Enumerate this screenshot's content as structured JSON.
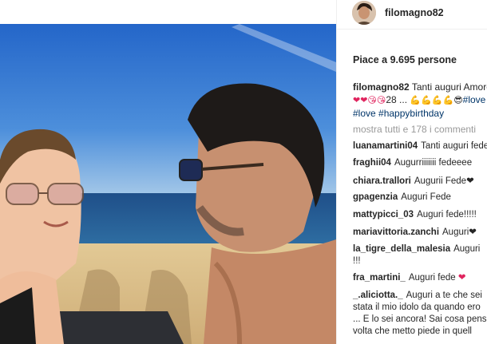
{
  "post": {
    "username": "filomagno82",
    "likes_text": "Piace a 9.695 persone",
    "caption": {
      "username": "filomagno82",
      "text": "Tanti auguri Amore",
      "line2_emoji_a": "❤❤😘😘",
      "line2_text": "28 ...",
      "line2_emoji_b": "💪💪💪💪😎",
      "line2_tag": "#love",
      "tags": [
        "#love",
        "#happybirthday"
      ]
    },
    "view_all": "mostra tutti e 178 i commenti"
  },
  "comments": [
    {
      "user": "luanamartini04",
      "text": "Tanti auguri fede"
    },
    {
      "user": "fraghii04",
      "text": "Augurriiiiiii fedeeee"
    },
    {
      "user": "chiara.trallori",
      "text": "Augurii Fede",
      "suffix": "❤"
    },
    {
      "user": "gpagenzia",
      "text": "Auguri Fede"
    },
    {
      "user": "mattypicci_03",
      "text": "Auguri fede!!!!!"
    },
    {
      "user": "mariavittoria.zanchi",
      "text": "Auguri",
      "suffix": "❤"
    },
    {
      "user": "la_tigre_della_malesia",
      "text": "Auguri",
      "line2": "!!!"
    },
    {
      "user": "fra_martini_",
      "text": "Auguri fede",
      "suffix": "❤"
    },
    {
      "user": "_.aliciotta._",
      "text": "Auguri a te che sei",
      "line2": "stata il mio idolo da quando ero",
      "line3": "... E lo sei ancora! Sai cosa pensi",
      "line4": "volta che metto piede in quell"
    }
  ],
  "icons": {
    "avatar": "avatar-image",
    "photo": "beach-selfie-photo"
  },
  "colors": {
    "accent_heart": "#e0245e",
    "hashtag": "#003569",
    "muted": "#999999"
  }
}
